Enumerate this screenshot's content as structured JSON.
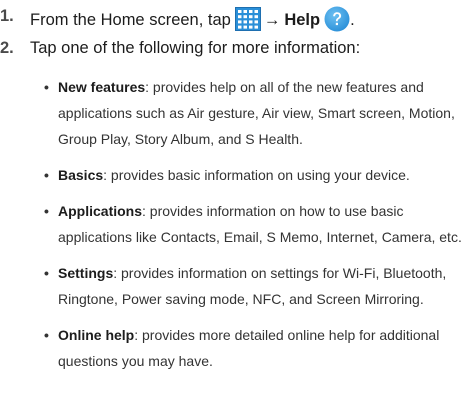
{
  "steps": [
    {
      "number": "1.",
      "prefix": "From the Home screen, tap",
      "arrow": "→",
      "target": "Help",
      "suffix": "."
    },
    {
      "number": "2.",
      "text": "Tap one of the following for more information:"
    }
  ],
  "icons": {
    "apps": "apps-grid-icon",
    "help": "help-question-icon"
  },
  "colors": {
    "icon_blue": "#2a8fd8",
    "text": "#1c1c1c"
  },
  "options": [
    {
      "term": "New features",
      "description": ": provides help on all of the new features and applications such as Air gesture, Air view, Smart screen, Motion, Group Play, Story Album, and S Health."
    },
    {
      "term": "Basics",
      "description": ": provides basic information on using your device."
    },
    {
      "term": "Applications",
      "description": ": provides information on how to use basic applications like Contacts, Email, S Memo, Internet, Camera, etc."
    },
    {
      "term": "Settings",
      "description": ": provides information on settings for Wi-Fi, Bluetooth, Ringtone, Power saving mode, NFC, and Screen Mirroring."
    },
    {
      "term": "Online help",
      "description": ": provides more detailed online help for additional questions you may have."
    }
  ]
}
